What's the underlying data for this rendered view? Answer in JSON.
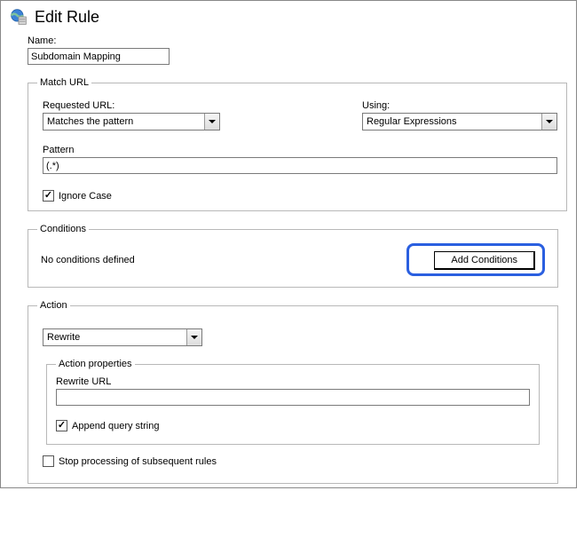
{
  "header": {
    "title": "Edit Rule"
  },
  "name": {
    "label": "Name:",
    "value": "Subdomain Mapping"
  },
  "match_url": {
    "legend": "Match URL",
    "requested_url": {
      "label": "Requested URL:",
      "value": "Matches the pattern"
    },
    "using": {
      "label": "Using:",
      "value": "Regular Expressions"
    },
    "pattern": {
      "label": "Pattern",
      "value": "(.*)"
    },
    "ignore_case": {
      "label": "Ignore Case",
      "checked": true
    }
  },
  "conditions": {
    "legend": "Conditions",
    "text": "No conditions defined",
    "add_button": "Add Conditions"
  },
  "action": {
    "legend": "Action",
    "type": {
      "value": "Rewrite"
    },
    "properties": {
      "legend": "Action properties",
      "rewrite_url": {
        "label": "Rewrite URL",
        "value": ""
      },
      "append_query": {
        "label": "Append query string",
        "checked": true
      }
    },
    "stop_processing": {
      "label": "Stop processing of subsequent rules",
      "checked": false
    }
  }
}
